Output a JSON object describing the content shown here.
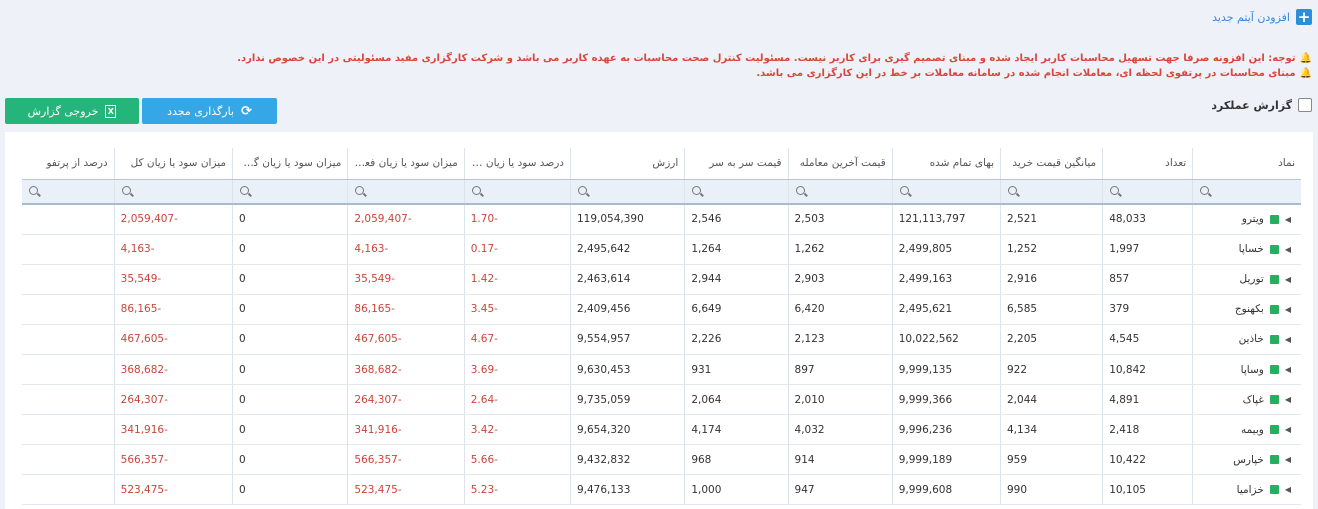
{
  "add_item": {
    "label": "افزودن آیتم جدید",
    "icon": "plus-icon"
  },
  "notes": [
    "توجه: این افزونه صرفا جهت تسهیل محاسبات کاربر ایجاد شده و مبنای تصمیم گیری برای کاربر نیست. مسئولیت کنترل صحت محاسبات به عهده کاربر می باشد و شرکت کارگزاری مفید مسئولیتی در این خصوص ندارد.",
    "مبنای محاسبات در پرتفوی لحظه ای، معاملات انجام شده در سامانه معاملات بر خط در این کارگزاری می باشد."
  ],
  "report_checkbox": {
    "label": "گزارش عملکرد",
    "checked": false
  },
  "buttons": {
    "reload": "بارگذاری مجدد",
    "export": "خروجی گزارش"
  },
  "colors": {
    "positive_square": "#27ae60",
    "negative_text": "#c9453a",
    "reload_btn": "#35a7e6",
    "export_btn": "#25b57a"
  },
  "table": {
    "columns": [
      "نماد",
      "تعداد",
      "میانگین قیمت خرید",
      "بهای تمام شده",
      "قیمت آخرین معامله",
      "قیمت سر به سر",
      "ارزش",
      "درصد سود یا زیان فعلی",
      "میزان سود یا زیان فعلی",
      "میزان سود یا زیان گذش...",
      "میزان سود یا زیان کل",
      "درصد از پرتفو"
    ],
    "rows": [
      {
        "symbol": "ویترو",
        "qty": "48,033",
        "avg_buy": "2,521",
        "cost": "121,113,797",
        "last": "2,503",
        "breakeven": "2,546",
        "value": "119,054,390",
        "pct": "-1.70",
        "pl_now": "-2,059,407",
        "pl_past": "0",
        "pl_total": "-2,059,407",
        "pct_port": ""
      },
      {
        "symbol": "خساپا",
        "qty": "1,997",
        "avg_buy": "1,252",
        "cost": "2,499,805",
        "last": "1,262",
        "breakeven": "1,264",
        "value": "2,495,642",
        "pct": "-0.17",
        "pl_now": "-4,163",
        "pl_past": "0",
        "pl_total": "-4,163",
        "pct_port": ""
      },
      {
        "symbol": "توریل",
        "qty": "857",
        "avg_buy": "2,916",
        "cost": "2,499,163",
        "last": "2,903",
        "breakeven": "2,944",
        "value": "2,463,614",
        "pct": "-1.42",
        "pl_now": "-35,549",
        "pl_past": "0",
        "pl_total": "-35,549",
        "pct_port": ""
      },
      {
        "symbol": "بکهنوج",
        "qty": "379",
        "avg_buy": "6,585",
        "cost": "2,495,621",
        "last": "6,420",
        "breakeven": "6,649",
        "value": "2,409,456",
        "pct": "-3.45",
        "pl_now": "-86,165",
        "pl_past": "0",
        "pl_total": "-86,165",
        "pct_port": ""
      },
      {
        "symbol": "خاذین",
        "qty": "4,545",
        "avg_buy": "2,205",
        "cost": "10,022,562",
        "last": "2,123",
        "breakeven": "2,226",
        "value": "9,554,957",
        "pct": "-4.67",
        "pl_now": "-467,605",
        "pl_past": "0",
        "pl_total": "-467,605",
        "pct_port": ""
      },
      {
        "symbol": "وساپا",
        "qty": "10,842",
        "avg_buy": "922",
        "cost": "9,999,135",
        "last": "897",
        "breakeven": "931",
        "value": "9,630,453",
        "pct": "-3.69",
        "pl_now": "-368,682",
        "pl_past": "0",
        "pl_total": "-368,682",
        "pct_port": ""
      },
      {
        "symbol": "غپاک",
        "qty": "4,891",
        "avg_buy": "2,044",
        "cost": "9,999,366",
        "last": "2,010",
        "breakeven": "2,064",
        "value": "9,735,059",
        "pct": "-2.64",
        "pl_now": "-264,307",
        "pl_past": "0",
        "pl_total": "-264,307",
        "pct_port": ""
      },
      {
        "symbol": "وبیمه",
        "qty": "2,418",
        "avg_buy": "4,134",
        "cost": "9,996,236",
        "last": "4,032",
        "breakeven": "4,174",
        "value": "9,654,320",
        "pct": "-3.42",
        "pl_now": "-341,916",
        "pl_past": "0",
        "pl_total": "-341,916",
        "pct_port": ""
      },
      {
        "symbol": "خپارس",
        "qty": "10,422",
        "avg_buy": "959",
        "cost": "9,999,189",
        "last": "914",
        "breakeven": "968",
        "value": "9,432,832",
        "pct": "-5.66",
        "pl_now": "-566,357",
        "pl_past": "0",
        "pl_total": "-566,357",
        "pct_port": ""
      },
      {
        "symbol": "خزامیا",
        "qty": "10,105",
        "avg_buy": "990",
        "cost": "9,999,608",
        "last": "947",
        "breakeven": "1,000",
        "value": "9,476,133",
        "pct": "-5.23",
        "pl_now": "-523,475",
        "pl_past": "0",
        "pl_total": "-523,475",
        "pct_port": ""
      }
    ]
  }
}
